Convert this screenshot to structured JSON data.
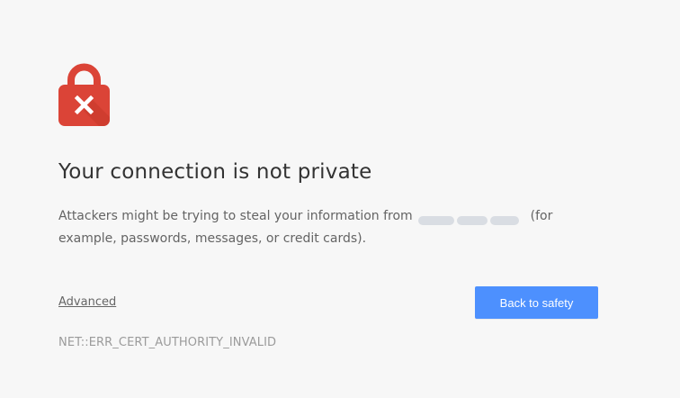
{
  "colors": {
    "background": "#f7f7f7",
    "lock_red": "#db4437",
    "button_blue": "#4d90fe",
    "heading": "#333333",
    "body_text": "#646464",
    "error_code": "#9b9b9b"
  },
  "icon": "lock-error-icon",
  "heading": "Your connection is not private",
  "description": {
    "before_host": "Attackers might be trying to steal your information from",
    "after_host": "(for example, passwords, messages, or credit cards)."
  },
  "advanced_label": "Advanced",
  "back_button_label": "Back to safety",
  "error_code": "NET::ERR_CERT_AUTHORITY_INVALID"
}
